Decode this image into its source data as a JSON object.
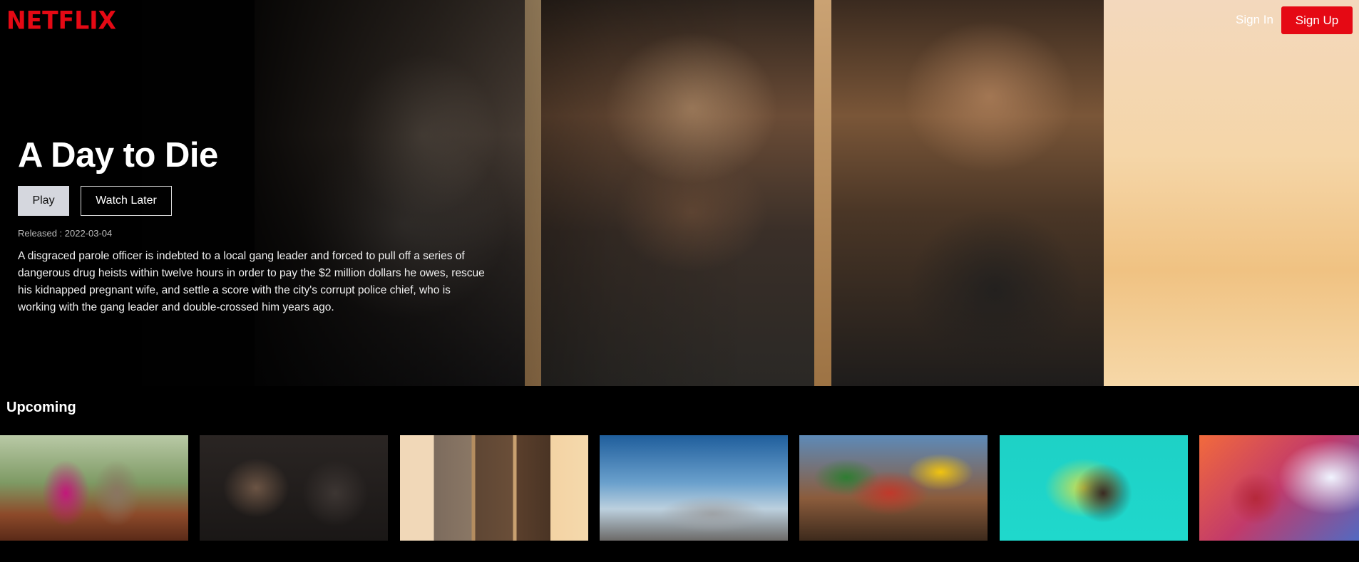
{
  "brand": {
    "logo_text": "NETFLIX",
    "color": "#e50914"
  },
  "nav": {
    "signin_label": "Sign In",
    "signup_label": "Sign Up"
  },
  "hero": {
    "title": "A Day to Die",
    "play_label": "Play",
    "watch_later_label": "Watch Later",
    "released": "Released : 2022-03-04",
    "overview": "A disgraced parole officer is indebted to a local gang leader and forced to pull off a series of dangerous drug heists within twelve hours in order to pay the $2 million dollars he owes, rescue his kidnapped pregnant wife, and settle a score with the city's corrupt police chief, who is working with the gang leader and double-crossed him years ago."
  },
  "upcoming": {
    "title": "Upcoming",
    "items": [
      {
        "image": "poster-jungle-adventure"
      },
      {
        "image": "poster-two-men-confrontation"
      },
      {
        "image": "poster-a-day-to-die"
      },
      {
        "image": "poster-fighter-plane"
      },
      {
        "image": "poster-my-hero-academia-world-heroes-mission"
      },
      {
        "image": "poster-teal-action-comedy"
      },
      {
        "image": "poster-thunder-god"
      }
    ]
  }
}
